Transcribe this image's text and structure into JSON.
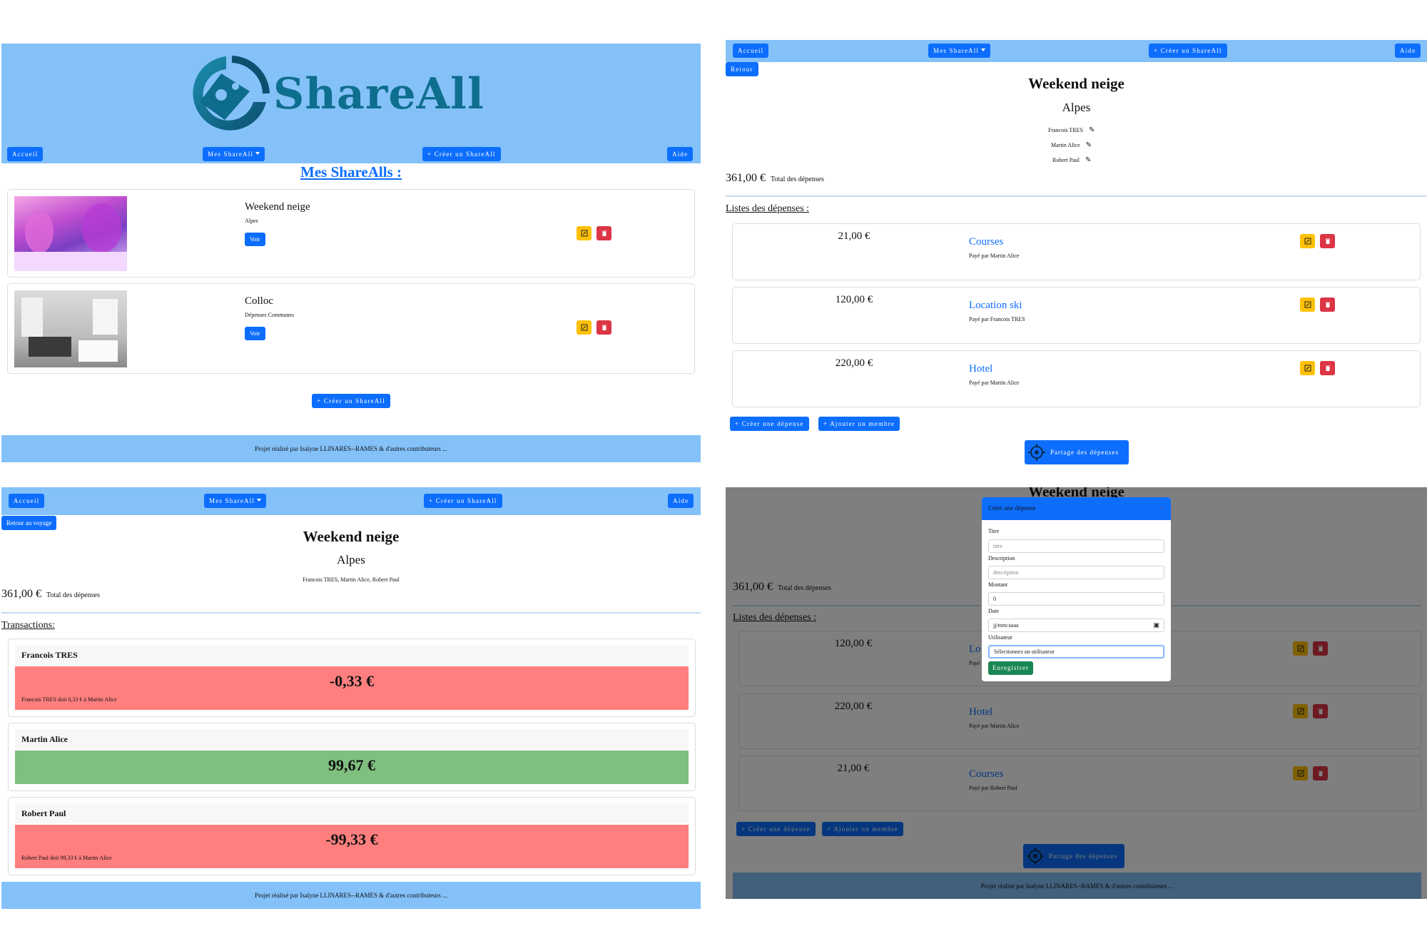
{
  "nav": {
    "home": "Accueil",
    "my_shareall": "Mes ShareAll",
    "create_shareall": "+ Créer un ShareAll",
    "help": "Aide"
  },
  "logo_text": "ShareAll",
  "footer_text": "Projet réalisé par Isalyne LLINARES--RAMES & d'autres contributeurs ...",
  "home_page": {
    "heading": "Mes ShareAlls :",
    "trips": [
      {
        "title": "Weekend neige",
        "subtitle": "Alpes",
        "view": "Voir"
      },
      {
        "title": "Colloc",
        "subtitle": "Dépenses Communes",
        "view": "Voir"
      }
    ],
    "create_button": "+ Créer un ShareAll"
  },
  "trip_page": {
    "back": "Retour",
    "title": "Weekend neige",
    "location": "Alpes",
    "members": [
      "Francois TRES",
      "Martin Alice",
      "Robert Paul"
    ],
    "total_amount": "361,00 €",
    "total_label": "Total des dépenses",
    "expenses_heading": "Listes des dépenses :",
    "expenses": [
      {
        "amount": "21,00 €",
        "title": "Courses",
        "paid_by": "Payé par Martin Alice"
      },
      {
        "amount": "120,00 €",
        "title": "Location ski",
        "paid_by": "Payé par Francois TRES"
      },
      {
        "amount": "220,00 €",
        "title": "Hotel",
        "paid_by": "Payé par Martin Alice"
      }
    ],
    "create_expense": "+ Créer une dépense",
    "add_member": "+ Ajouter un membre",
    "share_button": "Partage des dépenses"
  },
  "balance_page": {
    "back": "Retour au voyage",
    "title": "Weekend neige",
    "location": "Alpes",
    "members_line": "Francois TRES, Martin Alice, Robert Paul",
    "total_amount": "361,00 €",
    "total_label": "Total des dépenses",
    "transactions_heading": "Transactions:",
    "balances": [
      {
        "name": "Francois TRES",
        "amount": "-0,33 €",
        "note": "Francois TRES doit 0,33 € à Martin Alice",
        "status": "negative"
      },
      {
        "name": "Martin Alice",
        "amount": "99,67 €",
        "note": "",
        "status": "positive"
      },
      {
        "name": "Robert Paul",
        "amount": "-99,33 €",
        "note": "Robert Paul doit 99,33 € à Martin Alice",
        "status": "negative"
      }
    ]
  },
  "modal_page": {
    "behind_title": "Weekend neige",
    "total_amount": "361,00 €",
    "total_label": "Total des dépenses",
    "expenses_heading": "Listes des dépenses :",
    "expenses": [
      {
        "amount": "120,00 €",
        "title": "Lo",
        "paid_by": "Payé"
      },
      {
        "amount": "220,00 €",
        "title": "Hotel",
        "paid_by": "Payé par Martin Alice"
      },
      {
        "amount": "21,00 €",
        "title": "Courses",
        "paid_by": "Payé par Robert Paul"
      }
    ],
    "create_expense": "+ Créer une dépense",
    "add_member": "+ Ajouter un membre",
    "share_button": "Partage des dépenses",
    "modal": {
      "title": "Créer une dépense",
      "close": "×",
      "title_label": "Titre",
      "title_placeholder": "titre",
      "description_label": "Description",
      "description_placeholder": "description",
      "amount_label": "Montant",
      "amount_value": "0",
      "date_label": "Date",
      "date_placeholder": "jj/mm/aaaa",
      "user_label": "Utilisateur",
      "user_placeholder": "Sélectionnez un utilisateur",
      "save": "Enregistrer"
    }
  },
  "colors": {
    "navbar": "#84c1f9",
    "primary": "#0d6efd",
    "edit": "#ffc107",
    "delete": "#dc3545",
    "success": "#198754",
    "negative_bg": "#ff7f7f",
    "positive_bg": "#7fbf7f"
  }
}
